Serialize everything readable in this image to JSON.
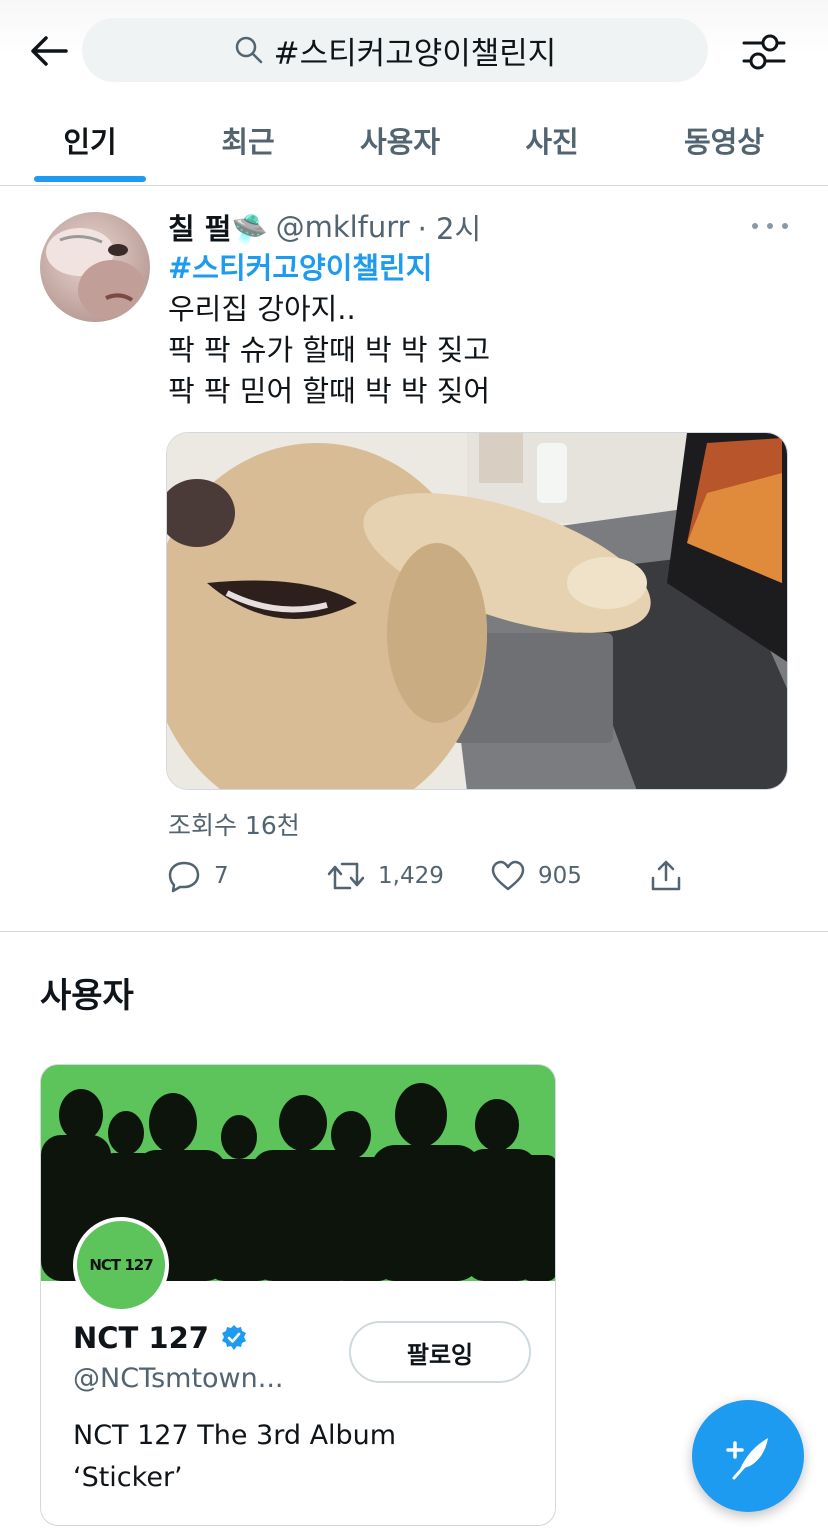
{
  "header": {
    "back_icon": "arrow-left-icon",
    "search_icon": "search-icon",
    "search_query": "#스티커고양이챌린지",
    "filter_icon": "sliders-icon"
  },
  "tabs": [
    {
      "label": "인기",
      "active": true
    },
    {
      "label": "최근",
      "active": false
    },
    {
      "label": "사용자",
      "active": false
    },
    {
      "label": "사진",
      "active": false
    },
    {
      "label": "동영상",
      "active": false
    }
  ],
  "tweet": {
    "display_name": "칠 펄🛸",
    "handle": "@mklfurr",
    "time": "· 2시",
    "hashtag": "#스티커고양이챌린지",
    "lines": [
      "우리집 강아지..",
      "팍 팍 슈가 할때 박 박 짖고",
      "팍 팍 믿어 할때 박 박 짖어"
    ],
    "views": "조회수 16천",
    "replies": "7",
    "retweets": "1,429",
    "likes": "905"
  },
  "users_section": {
    "title": "사용자",
    "card": {
      "avatar_text": "NCT 127",
      "name": "NCT 127",
      "handle": "@NCTsmtown...",
      "follow_label": "팔로잉",
      "bio_lines": [
        "NCT 127 The 3rd Album",
        "‘Sticker’"
      ],
      "banner_color": "#5dc35b"
    }
  },
  "colors": {
    "accent": "#1d9bf0",
    "secondary_text": "#536471"
  }
}
